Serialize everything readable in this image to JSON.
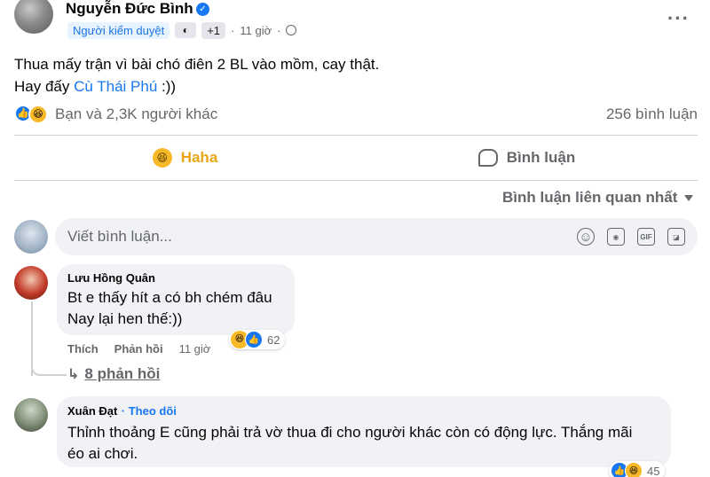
{
  "post": {
    "author": "Nguyễn Đức Bình",
    "badge": "Người kiểm duyệt",
    "badge_extra": "+1",
    "time": "11 giờ",
    "text_line1": "Thua mấy trận vì bài chó điên 2 BL vào mồm, cay thật.",
    "text_line2_prefix": "Hay đấy ",
    "mention": "Cù Thái Phú",
    "text_line2_suffix": " :))",
    "reactions_text": "Bạn và 2,3K người khác",
    "comment_count": "256 bình luận"
  },
  "actions": {
    "haha_label": "Haha",
    "comment_label": "Bình luận"
  },
  "sort": {
    "label": "Bình luận liên quan nhất"
  },
  "composer": {
    "placeholder": "Viết bình luận..."
  },
  "comments": [
    {
      "name": "Lưu Hồng Quân",
      "line1": "Bt e thấy hít a có bh chém đâu",
      "line2": "Nay lại hen thế:))",
      "like_label": "Thích",
      "reply_label": "Phản hồi",
      "time": "11 giờ",
      "reaction_count": "62",
      "replies_label": "8 phản hồi"
    },
    {
      "name": "Xuân Đạt",
      "follow": "· Theo dõi",
      "line1": "Thỉnh thoảng E cũng phải trả vờ thua đi cho người khác còn có động lực. Thắng mãi",
      "line2": "éo ai chơi.",
      "reaction_count": "45"
    }
  ],
  "icons": {
    "verified": "verified-check-icon",
    "more": "more-options-icon",
    "globe": "globe-icon",
    "like": "like-reaction-icon",
    "haha": "haha-reaction-icon",
    "comment": "comment-bubble-icon",
    "emoji": "emoji-icon",
    "camera": "camera-icon",
    "gif": "gif-icon",
    "sticker": "sticker-icon"
  },
  "colors": {
    "accent": "#1877f2",
    "haha": "#f7b928",
    "muted": "#65676b",
    "bubble": "#f0f2f5"
  }
}
